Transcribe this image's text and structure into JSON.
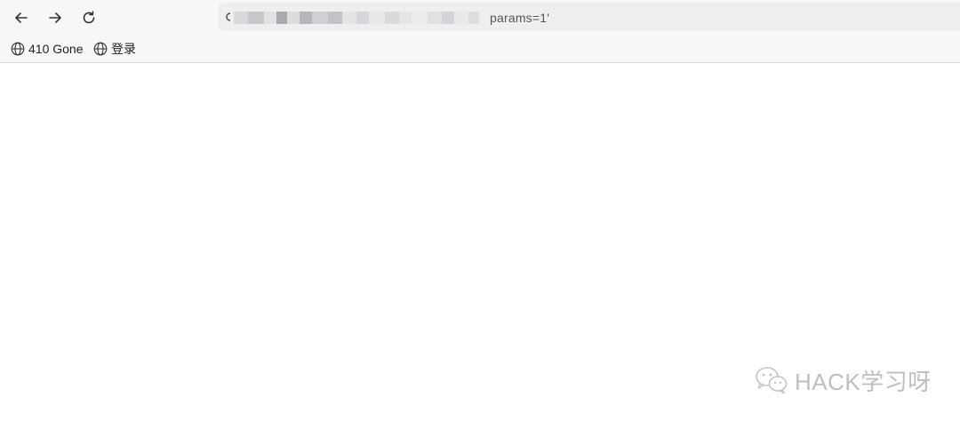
{
  "browser": {
    "url_visible_suffix": "params=1'",
    "nav": {
      "back_icon": "arrow-left-icon",
      "forward_icon": "arrow-right-icon",
      "reload_icon": "reload-icon"
    }
  },
  "bookmarks": [
    {
      "label": "410 Gone",
      "icon": "globe-icon"
    },
    {
      "label": "登录",
      "icon": "globe-icon"
    }
  ],
  "watermark": {
    "text": "HACK学习呀",
    "icon": "wechat-logo-icon"
  },
  "colors": {
    "toolbar_bg": "#f7f7f8",
    "address_bg": "#efeff2",
    "watermark": "#bfbfbf"
  }
}
